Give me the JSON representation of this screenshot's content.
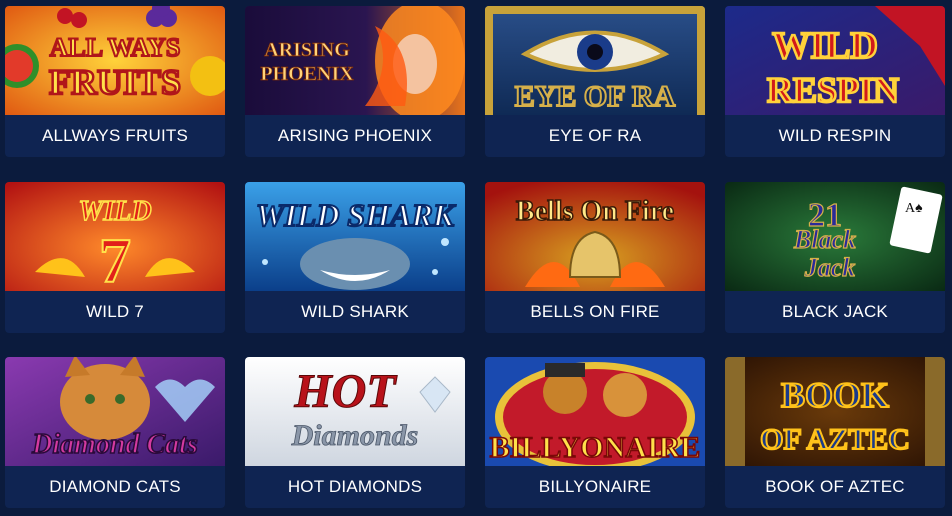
{
  "games": [
    {
      "label": "ALLWAYS FRUITS",
      "art_text": [
        "ALL WAYS",
        "FRUITS"
      ]
    },
    {
      "label": "ARISING PHOENIX",
      "art_text": [
        "ARISING",
        "PHOENIX"
      ]
    },
    {
      "label": "EYE OF RA",
      "art_text": [
        "EYE OF RA"
      ]
    },
    {
      "label": "WILD RESPIN",
      "art_text": [
        "WILD",
        "RESPIN"
      ]
    },
    {
      "label": "WILD 7",
      "art_text": [
        "WILD",
        "7"
      ]
    },
    {
      "label": "WILD SHARK",
      "art_text": [
        "WILD SHARK"
      ]
    },
    {
      "label": "BELLS ON FIRE",
      "art_text": [
        "Bells On Fire"
      ]
    },
    {
      "label": "BLACK JACK",
      "art_text": [
        "21",
        "Black",
        "Jack"
      ]
    },
    {
      "label": "DIAMOND CATS",
      "art_text": [
        "Diamond Cats"
      ]
    },
    {
      "label": "HOT DIAMONDS",
      "art_text": [
        "HOT",
        "Diamonds"
      ]
    },
    {
      "label": "BILLYONAIRE",
      "art_text": [
        "BILLYONAIRE"
      ]
    },
    {
      "label": "BOOK OF AZTEC",
      "art_text": [
        "BOOK",
        "OF AZTEC"
      ]
    }
  ],
  "colors": {
    "page_bg": "#0b1b3d",
    "card_bg": "#0f2452",
    "label_text": "#ffffff"
  }
}
